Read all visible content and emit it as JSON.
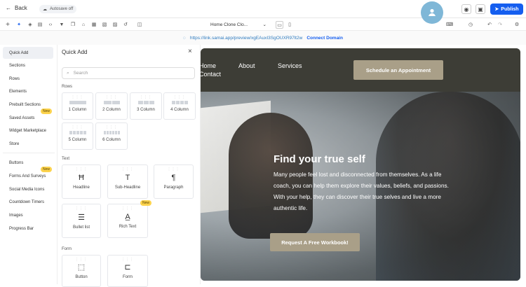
{
  "topbar": {
    "back_label": "Back",
    "autosave_label": "Autosave off",
    "publish_label": "Publish"
  },
  "toolbar": {
    "page_selector": "Home Clone Clo..."
  },
  "urlbar": {
    "url": "https://link.samai.app/preview/xgEAuxI3SgOUXR97lt2w",
    "connect_label": "Connect Domain"
  },
  "leftnav": {
    "items": [
      {
        "label": "Quick Add"
      },
      {
        "label": "Sections"
      },
      {
        "label": "Rows"
      },
      {
        "label": "Elements"
      },
      {
        "label": "Prebuilt Sections"
      },
      {
        "label": "Saved Assets",
        "badge": "New"
      },
      {
        "label": "Widget Marketplace"
      },
      {
        "label": "Store"
      },
      {
        "label": "Buttons"
      },
      {
        "label": "Forms And Surveys",
        "badge": "New"
      },
      {
        "label": "Social Media Icons"
      },
      {
        "label": "Countdown Timers"
      },
      {
        "label": "Images"
      },
      {
        "label": "Progress Bar"
      }
    ]
  },
  "panel": {
    "title": "Quick Add",
    "search_placeholder": "Search",
    "rows_title": "Rows",
    "rows": [
      "1 Column",
      "2 Column",
      "3 Column",
      "4 Column",
      "5 Column",
      "6 Column"
    ],
    "text_title": "Text",
    "text_items": [
      "Headline",
      "Sub-Headline",
      "Paragraph",
      "Bullet list",
      "Rich Text"
    ],
    "rich_text_badge": "New",
    "form_title": "Form",
    "form_items": [
      "Button",
      "Form"
    ]
  },
  "site": {
    "nav_home": "Home",
    "nav_about": "About",
    "nav_services": "Services",
    "nav_contact": "Contact",
    "cta": "Schedule an Appointment",
    "headline": "Find your true self",
    "paragraph": "Many people feel lost and disconnected from themselves. As a life coach, you can help them explore their values, beliefs, and passions. With your help, they can discover their true selves and live a more authentic life.",
    "cta2": "Request A Free Workbook!"
  },
  "colors": {
    "accent": "#155eef",
    "site_nav": "#3d3d36",
    "site_button": "#a99f88",
    "badge": "#fcd34d"
  }
}
